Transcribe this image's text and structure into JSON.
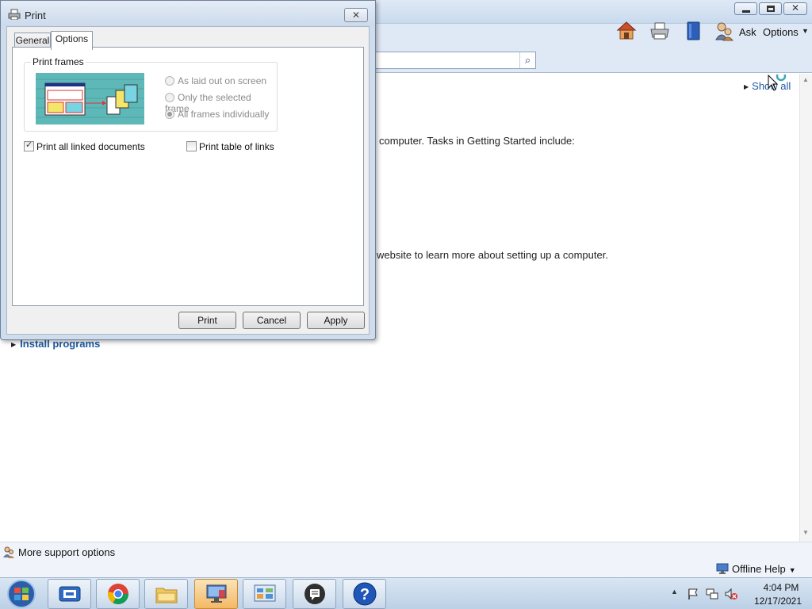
{
  "help_window": {
    "toolbar": {
      "ask_label": "Ask",
      "options_label": "Options",
      "icons": [
        "home-icon",
        "print-icon",
        "browse-help-icon",
        "ask-icon"
      ]
    },
    "search": {
      "value": "",
      "placeholder": ""
    },
    "content": {
      "show_all": "Show all",
      "text_1": "computer. Tasks in Getting Started include:",
      "text_2": "website to learn more about setting up a computer.",
      "install_programs": "Install programs"
    },
    "status": {
      "more_support": "More support options",
      "offline_help": "Offline Help"
    }
  },
  "print_dialog": {
    "title": "Print",
    "close_symbol": "✕",
    "tabs": [
      {
        "label": "General",
        "active": false
      },
      {
        "label": "Options",
        "active": true
      }
    ],
    "print_frames": {
      "legend": "Print frames",
      "options": [
        {
          "label": "As laid out on screen",
          "checked": false,
          "disabled": true
        },
        {
          "label": "Only the selected frame",
          "checked": false,
          "disabled": true
        },
        {
          "label": "All frames individually",
          "checked": true,
          "disabled": true
        }
      ]
    },
    "checkboxes": [
      {
        "label": "Print all linked documents",
        "checked": true
      },
      {
        "label": "Print table of links",
        "checked": false
      }
    ],
    "buttons": {
      "print": "Print",
      "cancel": "Cancel",
      "apply": "Apply"
    }
  },
  "taskbar": {
    "apps": [
      "remote-desktop-icon",
      "chrome-icon",
      "file-explorer-icon",
      "remote-desktop-active-icon",
      "control-panel-icon",
      "chat-icon",
      "help-icon"
    ],
    "clock": {
      "time": "4:04 PM",
      "date": "12/17/2021"
    }
  },
  "colors": {
    "link": "#1f5aa0",
    "titlebar": "#cfdcec",
    "taskbar": "#c9d9ec"
  }
}
